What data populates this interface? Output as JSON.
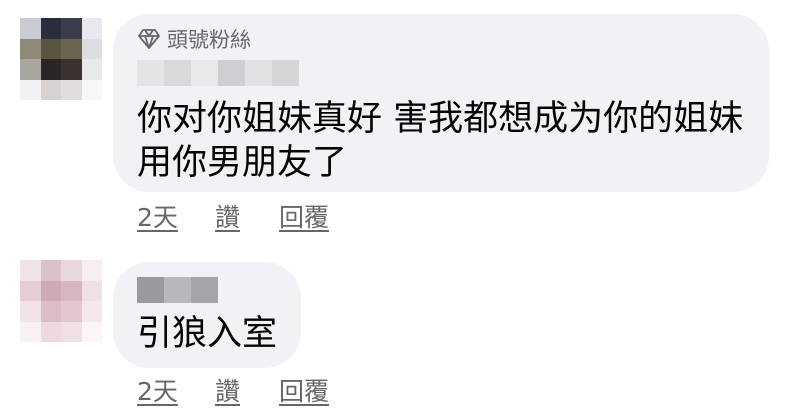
{
  "colors": {
    "bubble_bg": "#f0f2f5",
    "secondary_text": "#65676b",
    "primary_text": "#050505"
  },
  "comments": [
    {
      "badge_icon": "diamond-icon",
      "badge_label": "頭號粉絲",
      "text_line1": "你对你姐妹真好 害我都想成为你的姐妹",
      "text_line2": "用你男朋友了",
      "time": "2天",
      "like_label": "讚",
      "reply_label": "回覆"
    },
    {
      "text_line1": "引狼入室",
      "time": "2天",
      "like_label": "讚",
      "reply_label": "回覆"
    }
  ]
}
